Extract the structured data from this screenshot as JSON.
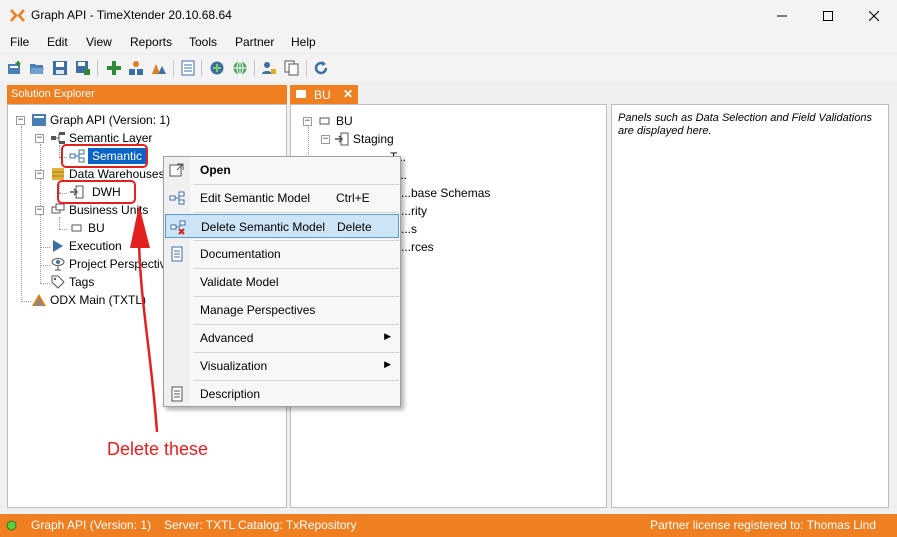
{
  "window": {
    "title": "Graph API - TimeXtender 20.10.68.64",
    "minimize_glyph": "—",
    "close_glyph": "✕"
  },
  "menubar": {
    "items": [
      "File",
      "Edit",
      "View",
      "Reports",
      "Tools",
      "Partner",
      "Help"
    ]
  },
  "toolbar": {
    "icons": [
      "new-project-icon",
      "open-icon",
      "save-icon",
      "save-as-icon",
      "add-icon",
      "deploy-icon",
      "execute-icon",
      "document-icon",
      "connect-icon",
      "globe-icon",
      "user-icon",
      "copy-icon",
      "refresh-icon"
    ]
  },
  "solution_explorer": {
    "title": "Solution Explorer",
    "tree": {
      "root": "Graph API (Version: 1)",
      "semantic_layer": "Semantic Layer",
      "semantic": "Semantic",
      "data_warehouses": "Data Warehouses",
      "dwh": "DWH",
      "business_units": "Business Units",
      "bu": "BU",
      "execution": "Execution",
      "project_perspectives": "Project Perspectives",
      "tags": "Tags",
      "odx": "ODX Main (TXTL)"
    }
  },
  "document_tab": {
    "label": "BU",
    "close_glyph": "✕"
  },
  "bu_tree": {
    "root": "BU",
    "staging": "Staging",
    "partial_items": [
      "T...",
      "...",
      "...base Schemas",
      "...rity",
      "...s",
      "...rces"
    ]
  },
  "right_panel": {
    "hint": "Panels such as Data Selection and Field Validations are displayed here."
  },
  "context_menu": {
    "items": [
      {
        "label": "Open",
        "shortcut": "",
        "bold": true,
        "icon": "open-external-icon"
      },
      {
        "label": "Edit Semantic Model",
        "shortcut": "Ctrl+E",
        "icon": "edit-model-icon"
      },
      {
        "label": "Delete Semantic Model",
        "shortcut": "Delete",
        "icon": "delete-model-icon",
        "highlighted": true
      },
      {
        "label": "Documentation",
        "shortcut": "",
        "icon": "documentation-icon"
      },
      {
        "label": "Validate Model",
        "shortcut": ""
      },
      {
        "label": "Manage Perspectives",
        "shortcut": ""
      },
      {
        "label": "Advanced",
        "shortcut": "",
        "submenu": true
      },
      {
        "label": "Visualization",
        "shortcut": "",
        "submenu": true
      },
      {
        "label": "Description",
        "shortcut": "",
        "icon": "description-icon"
      }
    ]
  },
  "annotation": {
    "text": "Delete these",
    "color": "#e32020"
  },
  "statusbar": {
    "project": "Graph API (Version: 1)",
    "server": "Server: TXTL Catalog: TxRepository",
    "license": "Partner license registered to: Thomas Lind"
  },
  "colors": {
    "accent": "#f07f22",
    "selection": "#0a64c8",
    "annotation": "#e32020"
  }
}
